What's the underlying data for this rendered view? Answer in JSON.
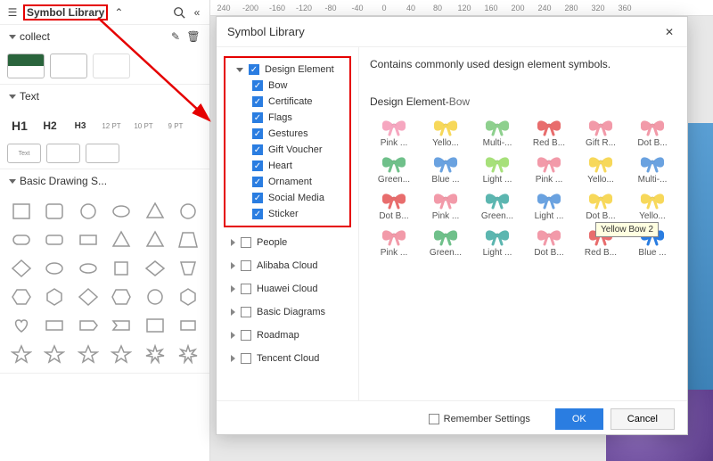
{
  "panel": {
    "title": "Symbol Library",
    "sections": {
      "collect": "collect",
      "text": "Text",
      "shapes": "Basic Drawing S..."
    },
    "text_items": [
      "H1",
      "H2",
      "H3",
      "12 PT",
      "10 PT",
      "9 PT"
    ]
  },
  "ruler": [
    "240",
    "-200",
    "-160",
    "-120",
    "-80",
    "-40",
    "0",
    "40",
    "80",
    "120",
    "160",
    "200",
    "240",
    "280",
    "320",
    "360"
  ],
  "dialog": {
    "title": "Symbol Library",
    "desc": "Contains commonly used design element symbols.",
    "preview_title_a": "Design Element-",
    "preview_title_b": "Bow",
    "tree": {
      "main": "Design Element",
      "children": [
        "Bow",
        "Certificate",
        "Flags",
        "Gestures",
        "Gift Voucher",
        "Heart",
        "Ornament",
        "Social Media",
        "Sticker"
      ],
      "others": [
        "People",
        "Alibaba Cloud",
        "Huawei Cloud",
        "Basic Diagrams",
        "Roadmap",
        "Tencent Cloud"
      ]
    },
    "grid": [
      {
        "l": "Pink ...",
        "c": "#f6a7c0"
      },
      {
        "l": "Yello...",
        "c": "#f7d85a"
      },
      {
        "l": "Multi-...",
        "c": "#8ed08e"
      },
      {
        "l": "Red B...",
        "c": "#e86d6d"
      },
      {
        "l": "Gift R...",
        "c": "#f29aa9"
      },
      {
        "l": "Dot B...",
        "c": "#f29aa9"
      },
      {
        "l": "Green...",
        "c": "#6fc08a"
      },
      {
        "l": "Blue ...",
        "c": "#6aa2e0"
      },
      {
        "l": "Light ...",
        "c": "#a7e07a"
      },
      {
        "l": "Pink ...",
        "c": "#f29aa9"
      },
      {
        "l": "Yello...",
        "c": "#f7d85a"
      },
      {
        "l": "Multi-...",
        "c": "#6aa2e0"
      },
      {
        "l": "Dot B...",
        "c": "#e86d6d"
      },
      {
        "l": "Pink ...",
        "c": "#f29aa9"
      },
      {
        "l": "Green...",
        "c": "#5cb6b0"
      },
      {
        "l": "Light ...",
        "c": "#6aa2e0"
      },
      {
        "l": "Dot B...",
        "c": "#f7d85a"
      },
      {
        "l": "Yello...",
        "c": "#f7d85a"
      },
      {
        "l": "Pink ...",
        "c": "#f29aa9"
      },
      {
        "l": "Green...",
        "c": "#6fc08a"
      },
      {
        "l": "Light ...",
        "c": "#5cb6b0"
      },
      {
        "l": "Dot B...",
        "c": "#f29aa9"
      },
      {
        "l": "Red B...",
        "c": "#e86d6d"
      },
      {
        "l": "Blue ...",
        "c": "#2a7de1"
      }
    ],
    "tooltip": "Yellow Bow 2",
    "remember": "Remember Settings",
    "ok": "OK",
    "cancel": "Cancel"
  }
}
